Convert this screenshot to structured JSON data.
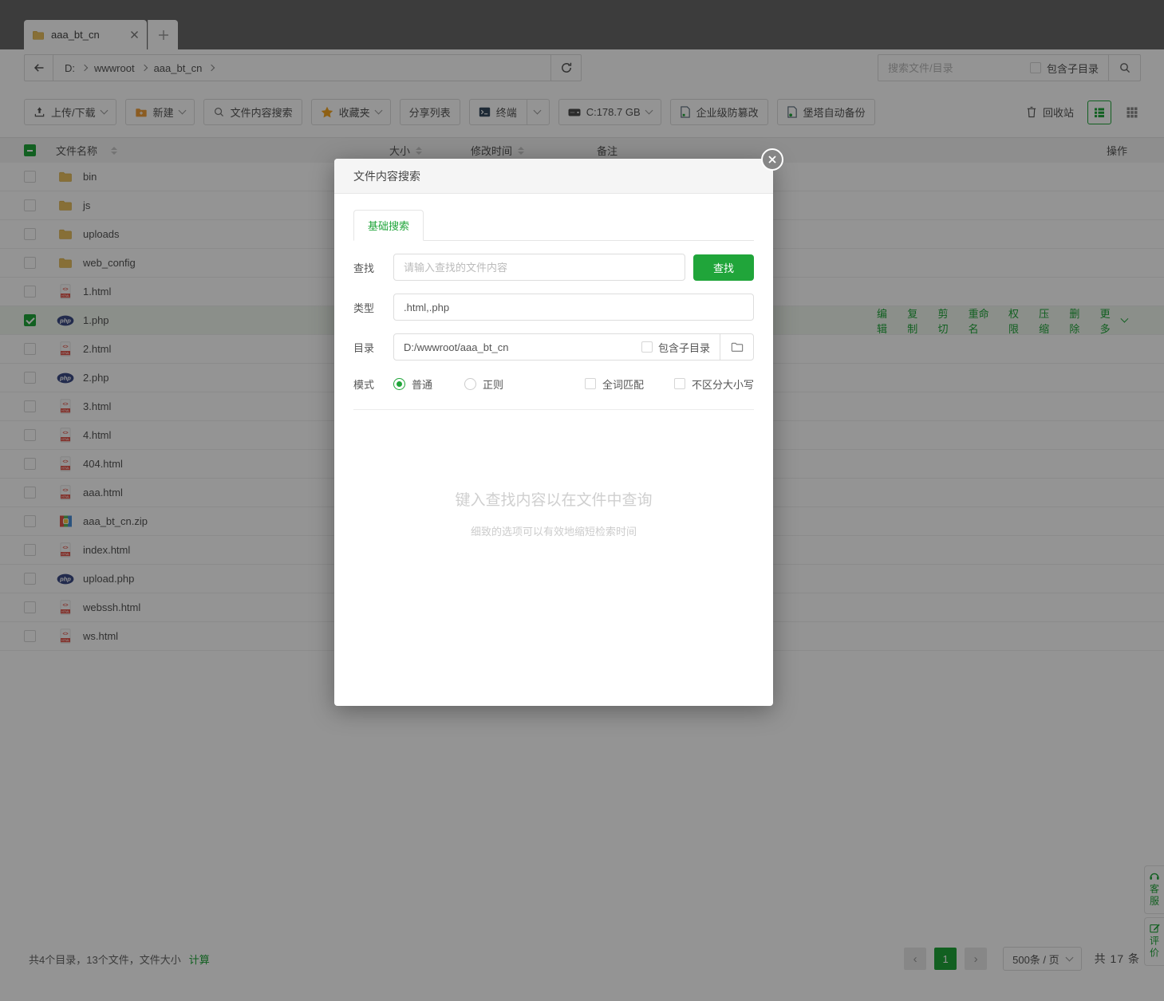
{
  "tabbar": {
    "active_tab": "aaa_bt_cn"
  },
  "breadcrumb": {
    "items": [
      "D:",
      "wwwroot",
      "aaa_bt_cn"
    ]
  },
  "top_search": {
    "placeholder": "搜索文件/目录",
    "include_subdir": "包含子目录"
  },
  "toolbar": {
    "upload": "上传/下载",
    "create": "新建",
    "content_search": "文件内容搜索",
    "favorites": "收藏夹",
    "share_list": "分享列表",
    "terminal": "终端",
    "disk": "C:178.7 GB",
    "tamper_proof": "企业级防篡改",
    "auto_backup": "堡塔自动备份",
    "recycle": "回收站"
  },
  "table": {
    "headers": {
      "name": "文件名称",
      "size": "大小",
      "time": "修改时间",
      "note": "备注",
      "actions": "操作"
    }
  },
  "files": [
    {
      "name": "bin",
      "type": "folder",
      "selected": false
    },
    {
      "name": "js",
      "type": "folder",
      "selected": false
    },
    {
      "name": "uploads",
      "type": "folder",
      "selected": false
    },
    {
      "name": "web_config",
      "type": "folder",
      "selected": false
    },
    {
      "name": "1.html",
      "type": "html",
      "selected": false
    },
    {
      "name": "1.php",
      "type": "php",
      "selected": true
    },
    {
      "name": "2.html",
      "type": "html",
      "selected": false
    },
    {
      "name": "2.php",
      "type": "php",
      "selected": false
    },
    {
      "name": "3.html",
      "type": "html",
      "selected": false
    },
    {
      "name": "4.html",
      "type": "html",
      "selected": false
    },
    {
      "name": "404.html",
      "type": "html",
      "selected": false
    },
    {
      "name": "aaa.html",
      "type": "html",
      "selected": false
    },
    {
      "name": "aaa_bt_cn.zip",
      "type": "zip",
      "selected": false
    },
    {
      "name": "index.html",
      "type": "html",
      "selected": false
    },
    {
      "name": "upload.php",
      "type": "php",
      "selected": false
    },
    {
      "name": "webssh.html",
      "type": "html",
      "selected": false
    },
    {
      "name": "ws.html",
      "type": "html",
      "selected": false
    }
  ],
  "row_actions": [
    "编辑",
    "复制",
    "剪切",
    "重命名",
    "权限",
    "压缩",
    "删除",
    "更多"
  ],
  "modal": {
    "title": "文件内容搜索",
    "tab": "基础搜索",
    "find": {
      "label": "查找",
      "placeholder": "请输入查找的文件内容",
      "button": "查找"
    },
    "type": {
      "label": "类型",
      "value": ".html,.php"
    },
    "dir": {
      "label": "目录",
      "value": "D:/wwwroot/aaa_bt_cn",
      "include_subdir": "包含子目录"
    },
    "mode": {
      "label": "模式",
      "normal": "普通",
      "regex": "正则",
      "whole_word": "全词匹配",
      "ignore_case": "不区分大小写"
    },
    "empty": {
      "title": "键入查找内容以在文件中查询",
      "subtitle": "细致的选项可以有效地缩短检索时间"
    }
  },
  "footer": {
    "summary": "共4个目录，13个文件，文件大小",
    "calculate": "计算",
    "prev": "‹",
    "page": "1",
    "next": "›",
    "per_page": "500条 / 页",
    "total": "共 17 条"
  },
  "side_widgets": {
    "support": "客服",
    "feedback": "评价"
  },
  "colors": {
    "accent": "#20a53a",
    "php_icon": "#3b4a85",
    "html_icon": "#e2574c",
    "folder_icon": "#e8c05f"
  }
}
